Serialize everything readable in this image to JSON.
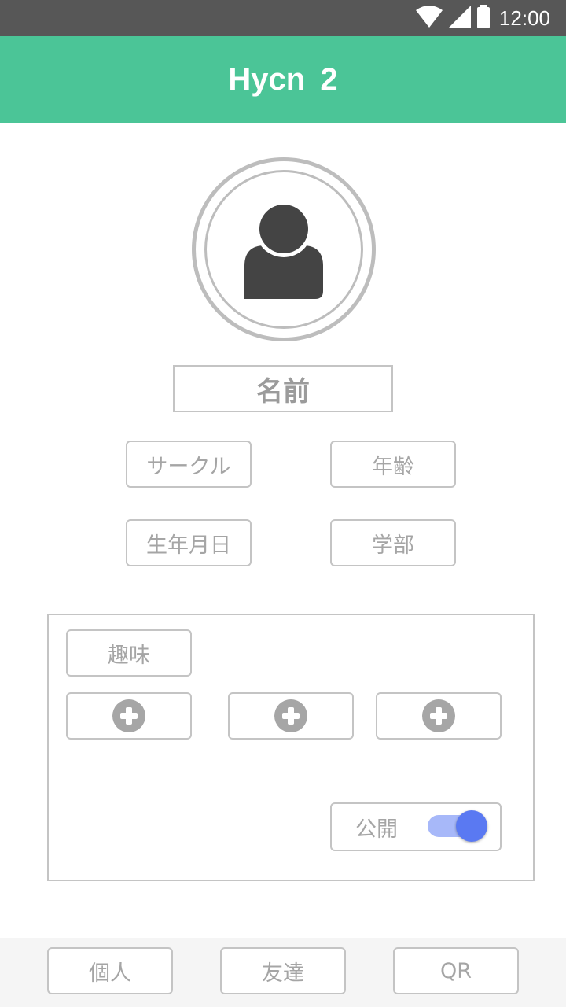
{
  "status_bar": {
    "time": "12:00",
    "icons": [
      "wifi-icon",
      "cellular-signal-icon",
      "battery-icon"
    ]
  },
  "app_bar": {
    "title": "Hycn 2",
    "background": "#4bc597"
  },
  "profile": {
    "avatar_icon": "person-icon",
    "name": "名前",
    "circle": "サークル",
    "age": "年齢",
    "birthday": "生年月日",
    "faculty": "学部"
  },
  "hobbies": {
    "label": "趣味",
    "add_icon": "plus-circle-icon",
    "public_label": "公開",
    "public_enabled": true
  },
  "bottom_nav": {
    "items": [
      {
        "label": "個人"
      },
      {
        "label": "友達"
      },
      {
        "label": "QR"
      }
    ]
  },
  "colors": {
    "accent": "#4bc597",
    "toggle_on": "#5a79f2",
    "border": "#c4c4c4",
    "text": "#a5a5a5"
  }
}
